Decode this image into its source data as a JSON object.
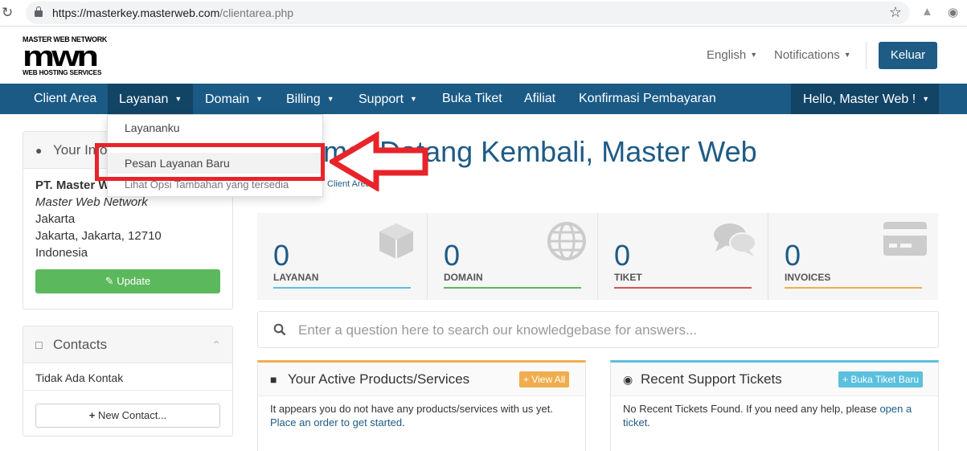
{
  "browser": {
    "url_host": "https://masterkey.masterweb.com",
    "url_path": "/clientarea.php"
  },
  "logo": {
    "top_text": "MASTER WEB NETWORK",
    "mark_text": "mwn",
    "bottom_text": "WEB HOSTING SERVICES"
  },
  "header": {
    "language": "English",
    "notifications": "Notifications",
    "logout": "Keluar"
  },
  "nav": {
    "items": [
      "Client Area",
      "Layanan",
      "Domain",
      "Billing",
      "Support",
      "Buka Tiket",
      "Afiliat",
      "Konfirmasi Pembayaran"
    ],
    "user": "Hello, Master Web !"
  },
  "dropdown": {
    "items": [
      "Layananku",
      "Pesan Layanan Baru",
      "Lihat Opsi Tambahan yang tersedia"
    ]
  },
  "sidebar": {
    "info_title": "Your Info",
    "company": "PT. Master Web",
    "company_alt": "Master Web Network",
    "city": "Jakarta",
    "address": "Jakarta, Jakarta, 12710",
    "country": "Indonesia",
    "update_label": "Update",
    "contacts_title": "Contacts",
    "no_contacts": "Tidak Ada Kontak",
    "new_contact_label": "New Contact..."
  },
  "main": {
    "title": "Selamat Datang Kembali, Master Web",
    "breadcrumb": "Client Area",
    "tiles": [
      {
        "value": "0",
        "label": "LAYANAN",
        "color": "#5bc0de"
      },
      {
        "value": "0",
        "label": "DOMAIN",
        "color": "#5cb85c"
      },
      {
        "value": "0",
        "label": "TIKET",
        "color": "#d9534f"
      },
      {
        "value": "0",
        "label": "INVOICES",
        "color": "#f0ad4e"
      }
    ],
    "kb_placeholder": "Enter a question here to search our knowledgebase for answers...",
    "products_card": {
      "title": "Your Active Products/Services",
      "button": "View All",
      "text": "It appears you do not have any products/services with us yet.",
      "link": "Place an order to get started",
      "accent": "#f0ad4e"
    },
    "tickets_card": {
      "title": "Recent Support Tickets",
      "button": "Buka Tiket Baru",
      "text": "No Recent Tickets Found. If you need any help, please",
      "link": "open a ticket",
      "accent": "#5bc0de"
    }
  }
}
